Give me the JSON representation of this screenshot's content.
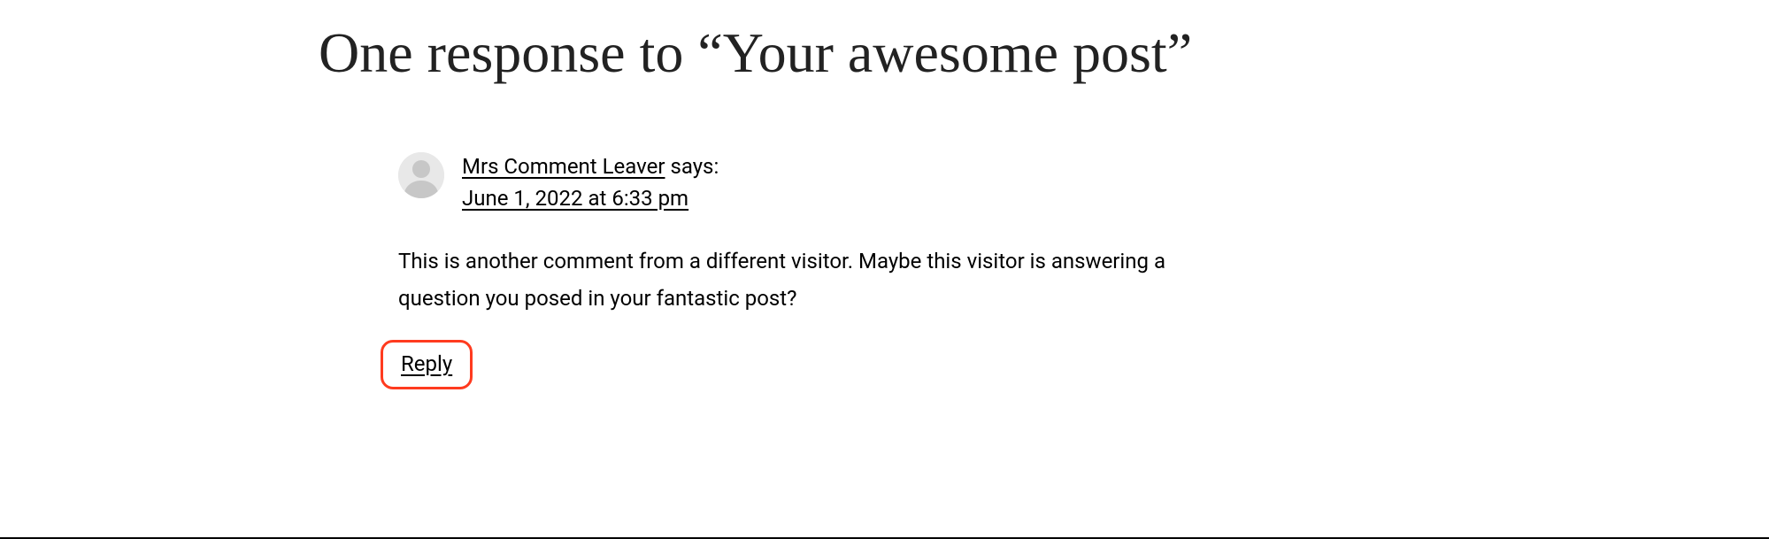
{
  "heading": "One response to “Your awesome post”",
  "comment": {
    "author": "Mrs Comment Leaver",
    "says_label": " says:",
    "timestamp": "June 1, 2022 at 6:33 pm",
    "body": "This is another comment from a different visitor. Maybe this visitor is answering a question you posed in your fantastic post?",
    "reply_label": "Reply"
  }
}
